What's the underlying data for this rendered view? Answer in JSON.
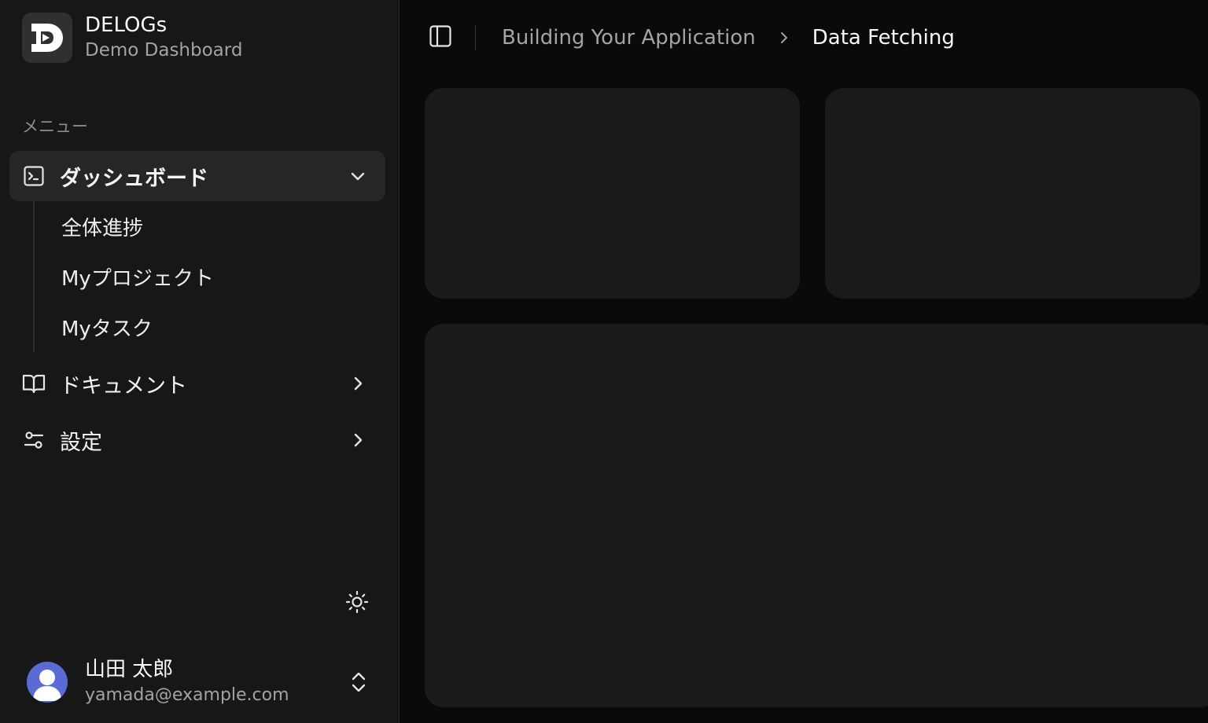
{
  "brand": {
    "name": "DELOGs",
    "subtitle": "Demo Dashboard"
  },
  "sidebar": {
    "menu_label": "メニュー",
    "items": [
      {
        "label": "ダッシュボード",
        "icon": "terminal-square-icon",
        "expanded": true,
        "subitems": [
          "全体進捗",
          "Myプロジェクト",
          "Myタスク"
        ]
      },
      {
        "label": "ドキュメント",
        "icon": "book-open-icon",
        "expanded": false
      },
      {
        "label": "設定",
        "icon": "sliders-icon",
        "expanded": false
      }
    ]
  },
  "user": {
    "name": "山田 太郎",
    "email": "yamada@example.com"
  },
  "breadcrumb": {
    "parent": "Building Your Application",
    "current": "Data Fetching"
  },
  "colors": {
    "sidebar_bg": "#171717",
    "main_bg": "#0a0a0a",
    "card_bg": "#1a1a1a",
    "active_item_bg": "#262626",
    "avatar_bg": "#5b6bd6"
  }
}
